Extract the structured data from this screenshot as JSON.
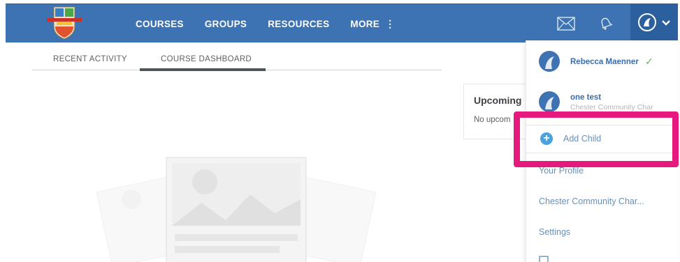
{
  "nav": {
    "items": [
      {
        "label": "COURSES"
      },
      {
        "label": "GROUPS"
      },
      {
        "label": "RESOURCES"
      },
      {
        "label": "MORE"
      }
    ],
    "more_icon": "vertical-dots-icon",
    "icons": [
      "mail-icon",
      "bell-icon",
      "avatar-icon",
      "chevron-down-icon"
    ],
    "bar_color": "#3d72b3"
  },
  "tabs": [
    {
      "label": "RECENT ACTIVITY",
      "active": false
    },
    {
      "label": "COURSE DASHBOARD",
      "active": true
    }
  ],
  "upcoming": {
    "title": "Upcoming",
    "body": "No upcom"
  },
  "dropdown": {
    "users": [
      {
        "name": "Rebecca Maenner",
        "subtitle": "",
        "selected": true
      },
      {
        "name": "one test",
        "subtitle": "Chester Community Char",
        "selected": false
      }
    ],
    "add_child": "Add Child",
    "links": [
      {
        "label": "Your Profile"
      },
      {
        "label": "Chester Community Char..."
      },
      {
        "label": "Settings"
      }
    ]
  },
  "highlight_color": "#e5197e"
}
